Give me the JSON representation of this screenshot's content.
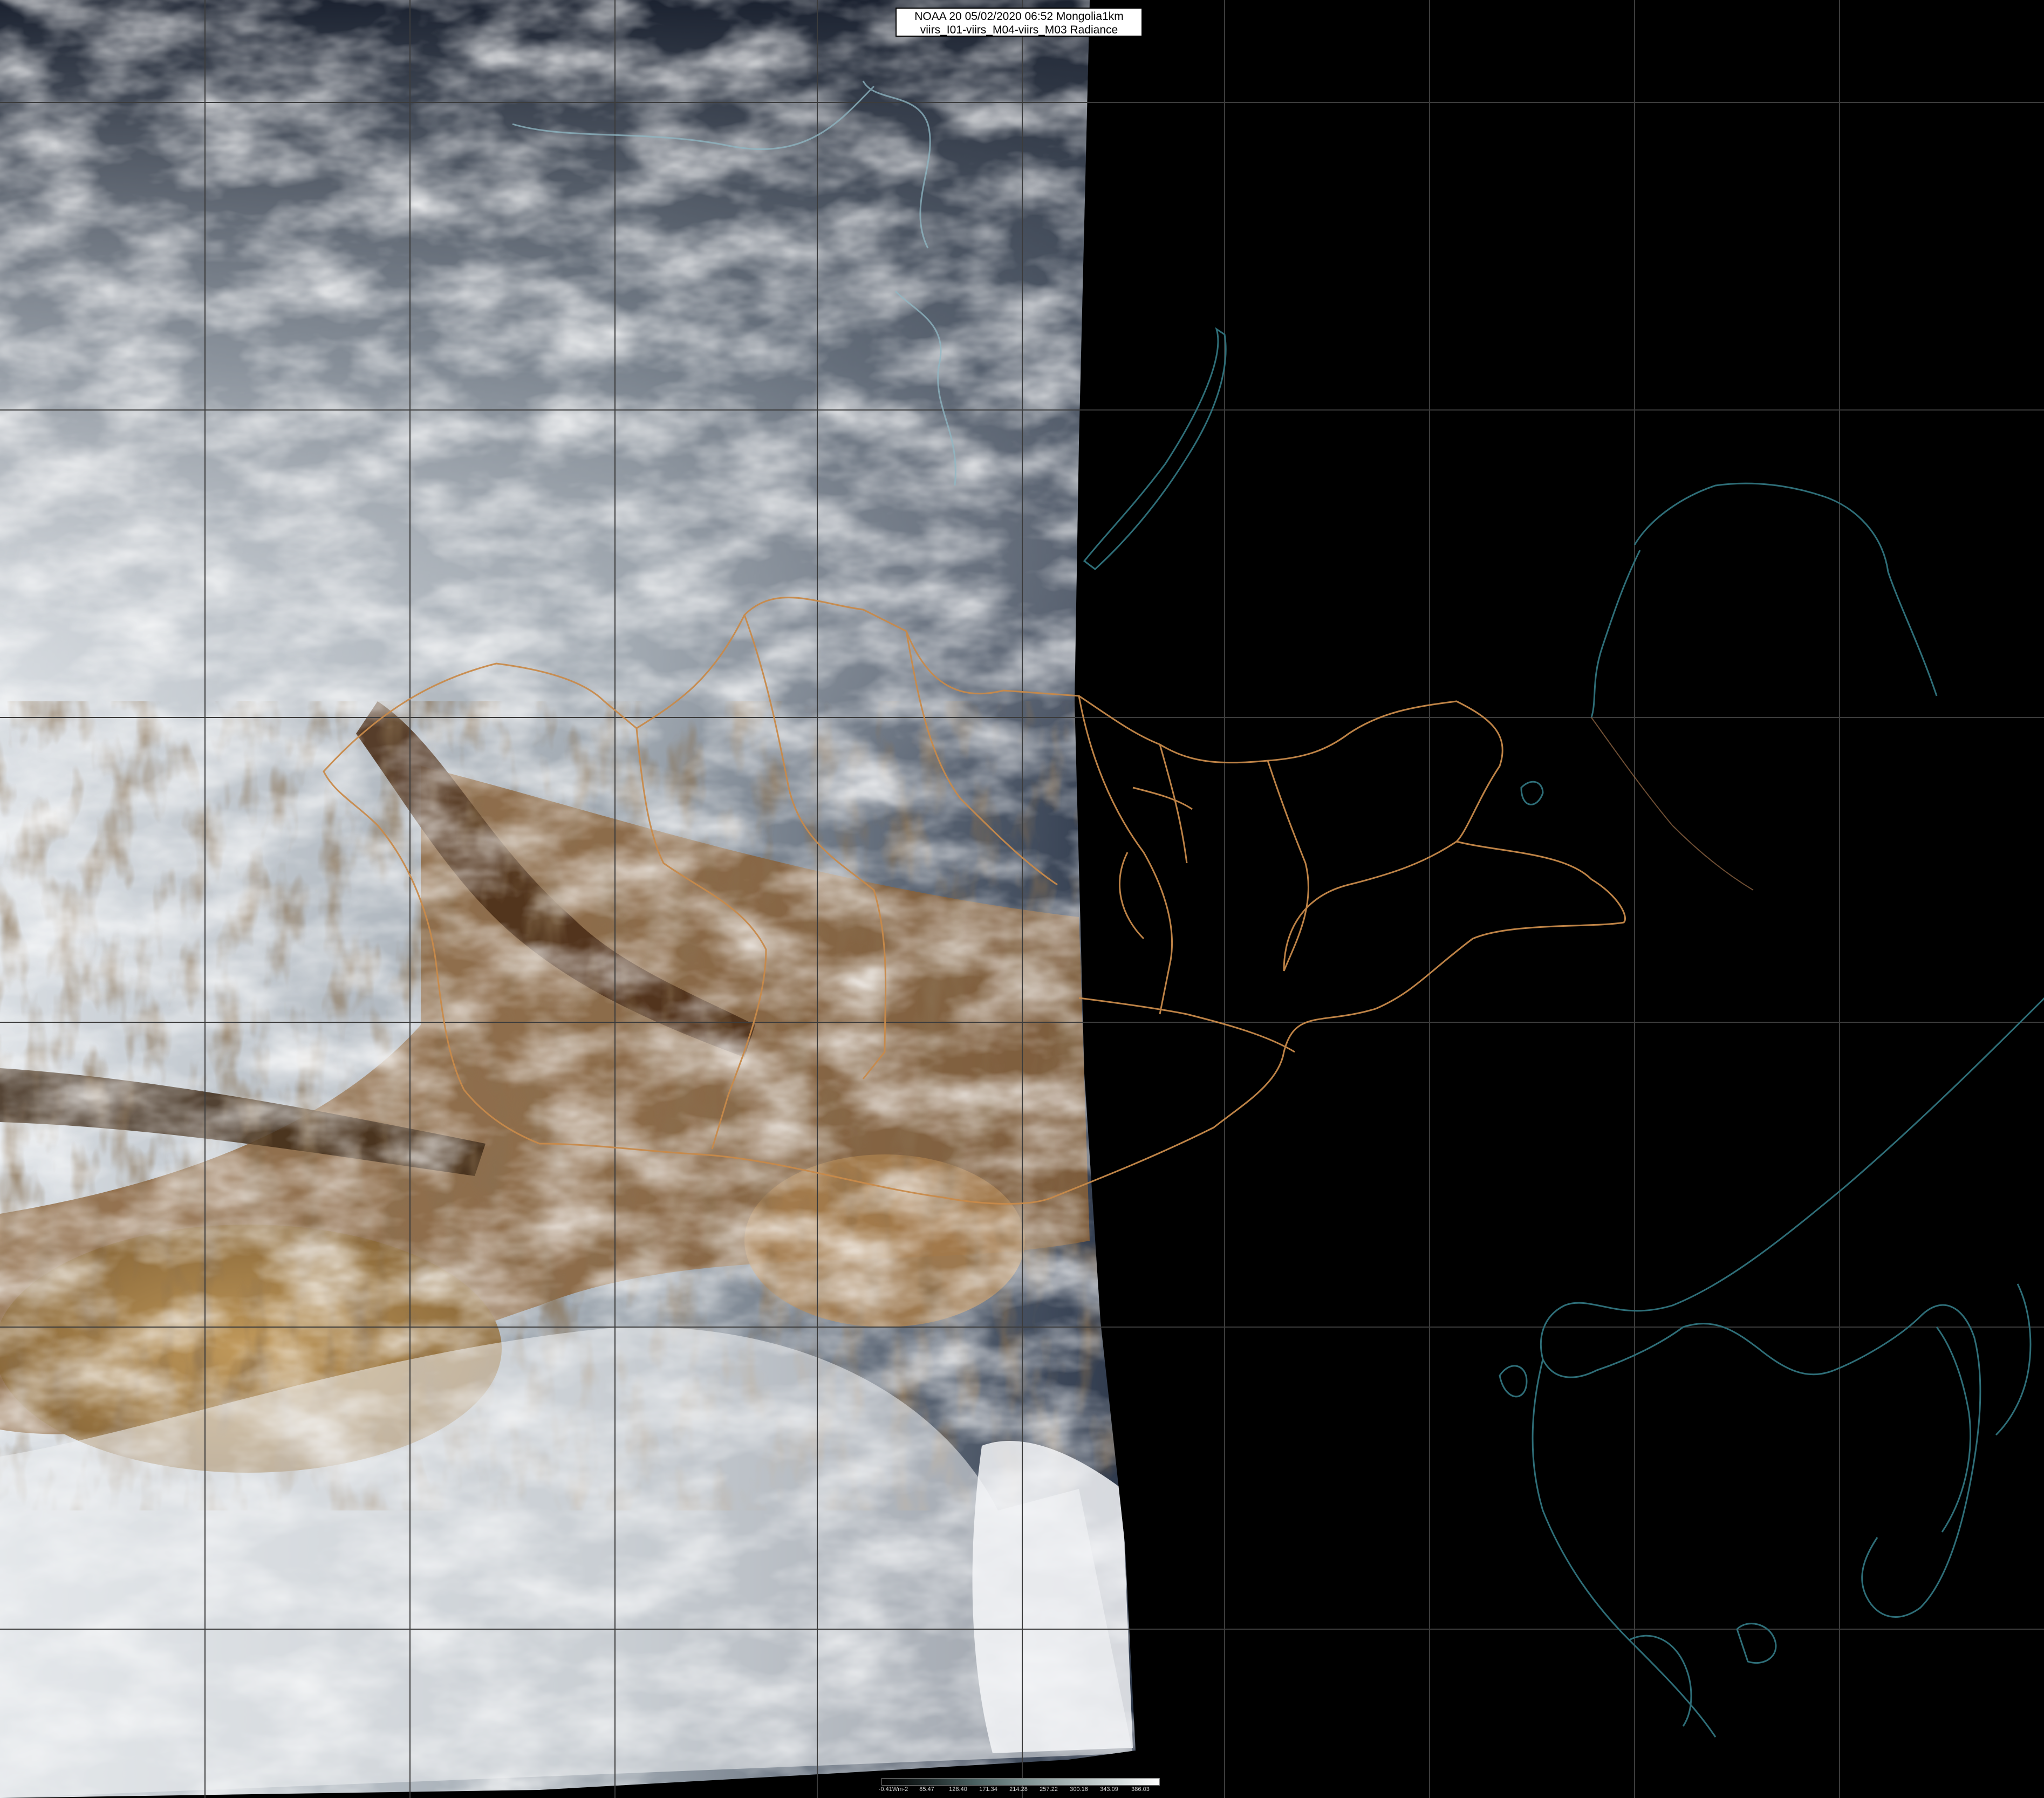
{
  "header": {
    "line1": "NOAA 20 05/02/2020 06:52 Mongolia1km",
    "line2": "viirs_I01-viirs_M04-viirs_M03 Radiance"
  },
  "colorbar": {
    "labels": [
      "-0.41Wm-2",
      "85.47",
      "128.40",
      "171.34",
      "214.28",
      "257.22",
      "300.16",
      "343.09",
      "386.03"
    ],
    "gradient_colors": [
      "#000000",
      "#1f2a2a",
      "#4a6060",
      "#7a8e8e",
      "#a6b4b4",
      "#cfd8d8",
      "#ffffff"
    ]
  },
  "scene": {
    "description_colors": {
      "snow_cloud": "#e9edf0",
      "desert": "#b28a4e",
      "rock": "#5a3e24",
      "night": "#000000",
      "coastline": "#2e6e78",
      "province_border": "#c88a4a",
      "graticule": "#3a3a3a"
    }
  }
}
